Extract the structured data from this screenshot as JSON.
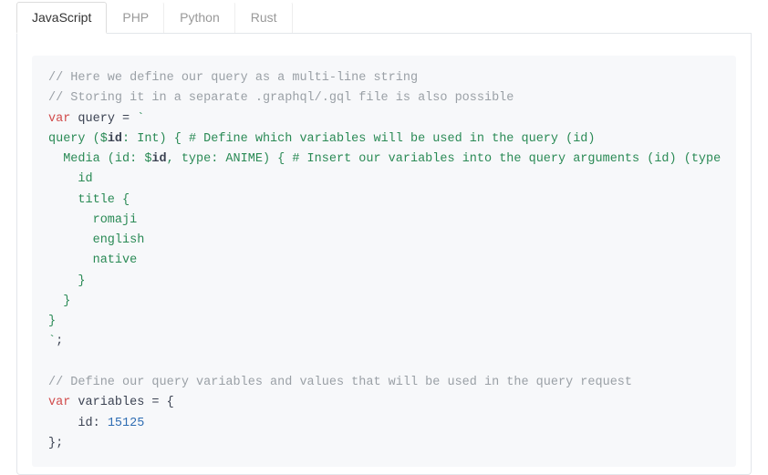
{
  "tabs": {
    "items": [
      {
        "label": "JavaScript",
        "active": true
      },
      {
        "label": "PHP",
        "active": false
      },
      {
        "label": "Python",
        "active": false
      },
      {
        "label": "Rust",
        "active": false
      }
    ]
  },
  "code": {
    "c1": "// Here we define our query as a multi-line string",
    "c2": "// Storing it in a separate .graphql/.gql file is also possible",
    "kw_var1": "var",
    "query_name": " query = ",
    "backtick1": "`",
    "q_line1a": "query ($",
    "q_line1b": "id",
    "q_line1c": ": Int) { ",
    "q_hash1": "# Define which variables will be used in the query (id)",
    "q_line2a": "  Media (id: $",
    "q_line2b": "id",
    "q_line2c": ", type: ANIME) { ",
    "q_hash2": "# Insert our variables into the query arguments (id) (type",
    "q_line3": "    id",
    "q_line4": "    title {",
    "q_line5": "      romaji",
    "q_line6": "      english",
    "q_line7": "      native",
    "q_line8": "    }",
    "q_line9": "  }",
    "q_line10": "}",
    "backtick2": "`",
    "semi1": ";",
    "c3": "// Define our query variables and values that will be used in the query request",
    "kw_var2": "var",
    "vars_name": " variables = {",
    "v_line1a": "    ",
    "v_line1b": "id",
    "v_line1c": ": ",
    "v_line1d": "15125",
    "v_close": "};"
  }
}
